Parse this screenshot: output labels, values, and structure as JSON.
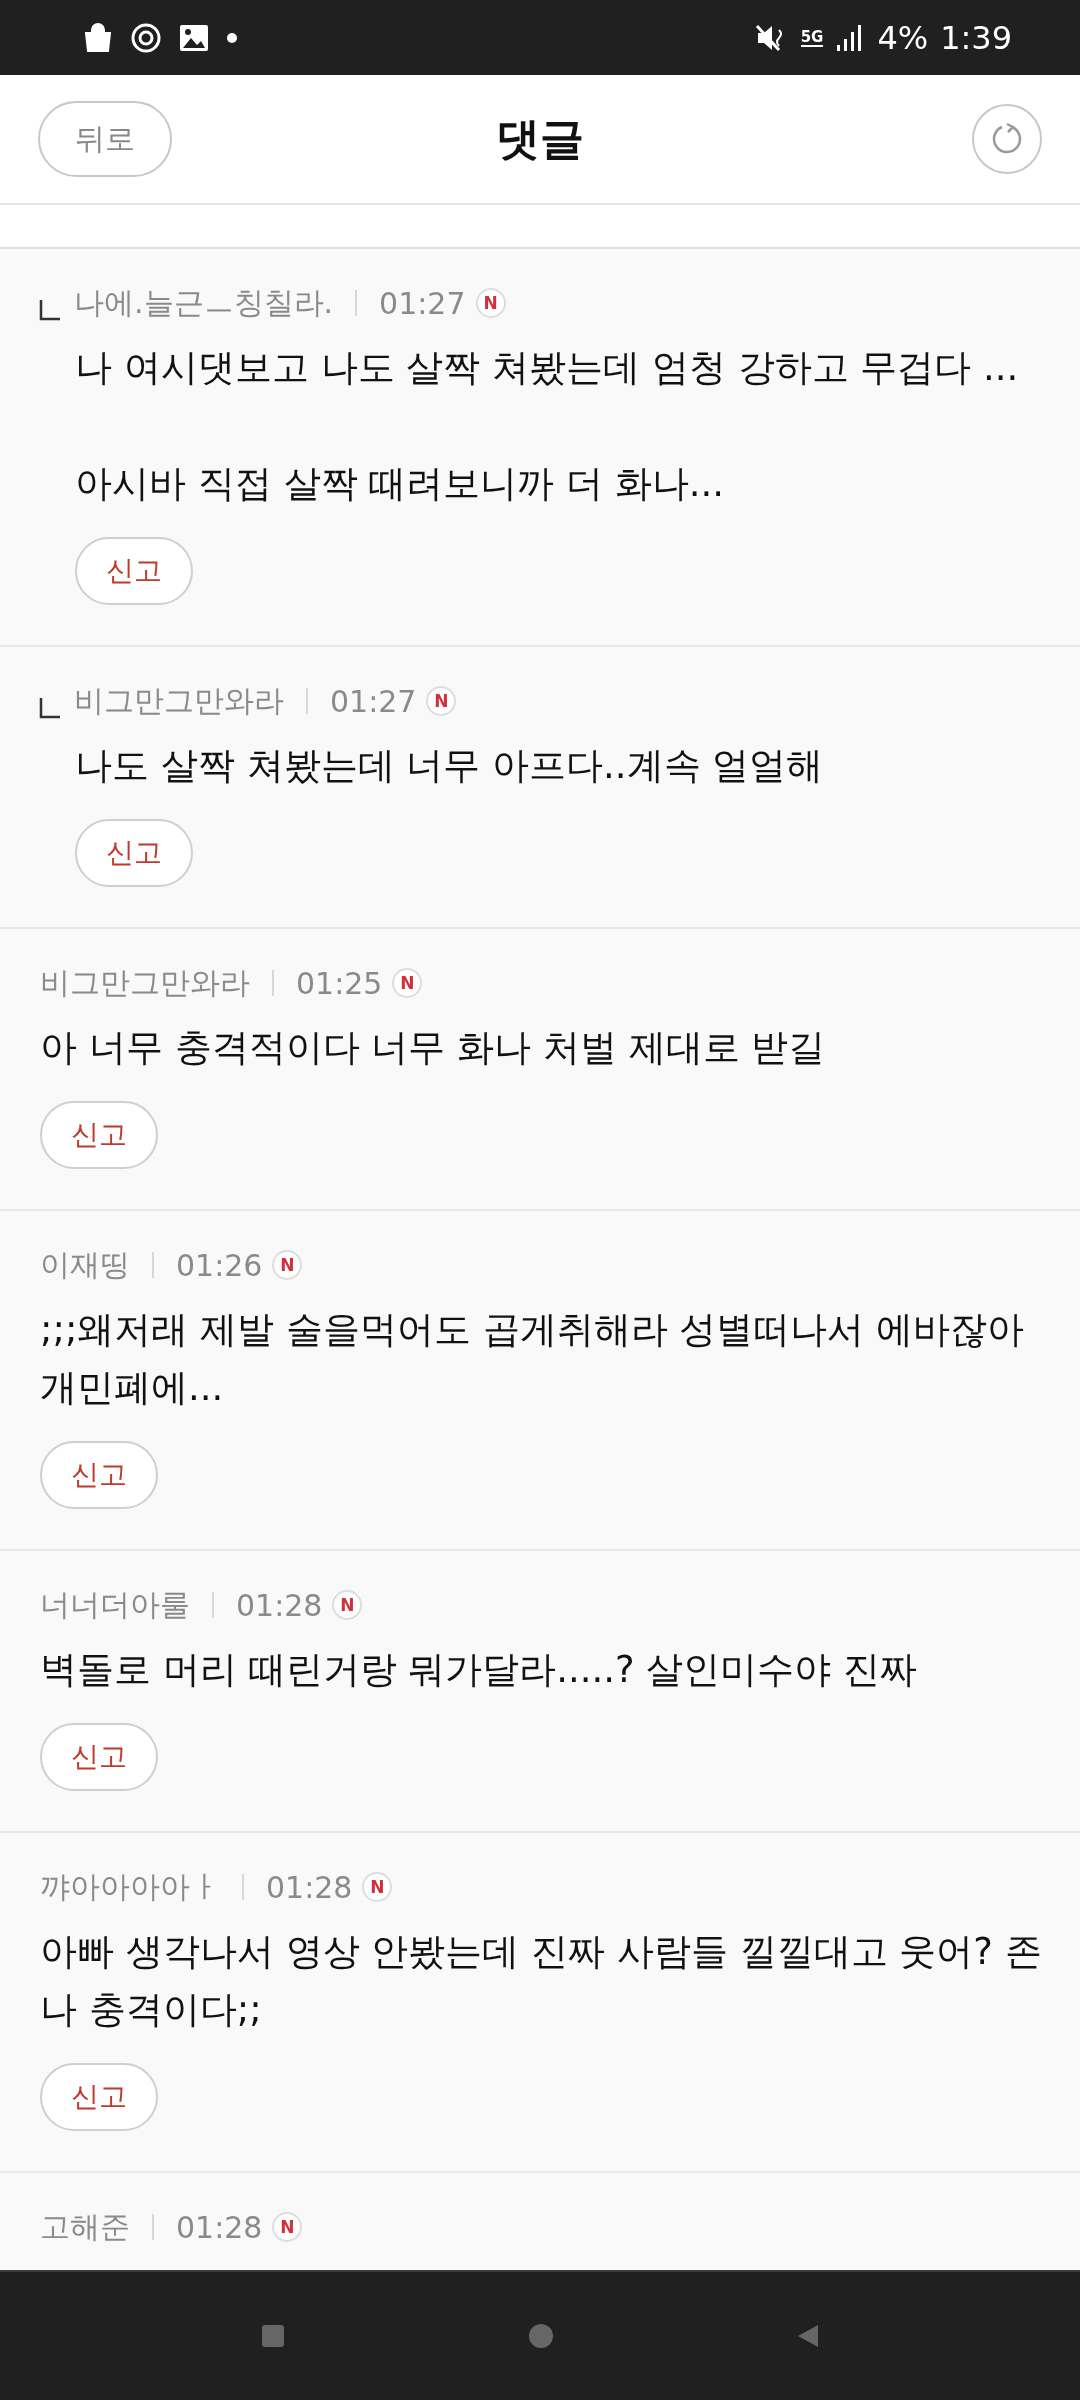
{
  "status_bar": {
    "network": "5G",
    "battery": "4%",
    "time": "1:39"
  },
  "header": {
    "back": "뒤로",
    "title": "댓글"
  },
  "comments": [
    {
      "kind": "reply",
      "author": "나에.늘근ㅡ칭칠라.",
      "time": "01:27",
      "badge": "N",
      "text": "나 여시댓보고 나도 살짝 쳐봤는데 엄청 강하고 무겁다 ...\n\n아시바 직접 살짝 때려보니까 더 화나...",
      "report": "신고"
    },
    {
      "kind": "reply",
      "author": "비그만그만와라",
      "time": "01:27",
      "badge": "N",
      "text": "나도 살짝 쳐봤는데 너무 아프다..계속 얼얼해",
      "report": "신고"
    },
    {
      "kind": "comment",
      "author": "비그만그만와라",
      "time": "01:25",
      "badge": "N",
      "text": "아 너무 충격적이다 너무 화나 처벌 제대로 받길",
      "report": "신고"
    },
    {
      "kind": "comment",
      "author": "이재띵",
      "time": "01:26",
      "badge": "N",
      "text": ";;;왜저래 제발 술을먹어도 곱게취해라 성별떠나서 에바잖아 개민폐에...",
      "report": "신고"
    },
    {
      "kind": "comment",
      "author": "너너더아룰",
      "time": "01:28",
      "badge": "N",
      "text": "벽돌로 머리 때린거랑 뭐가달라.....? 살인미수야 진짜",
      "report": "신고"
    },
    {
      "kind": "comment",
      "author": "꺄아아아아ㅏ",
      "time": "01:28",
      "badge": "N",
      "text": "아빠 생각나서 영상 안봤는데 진짜 사람들 낄낄대고 웃어? 존나 충격이다;;",
      "report": "신고"
    },
    {
      "kind": "comment",
      "author": "고해준",
      "time": "01:28",
      "badge": "N"
    }
  ]
}
